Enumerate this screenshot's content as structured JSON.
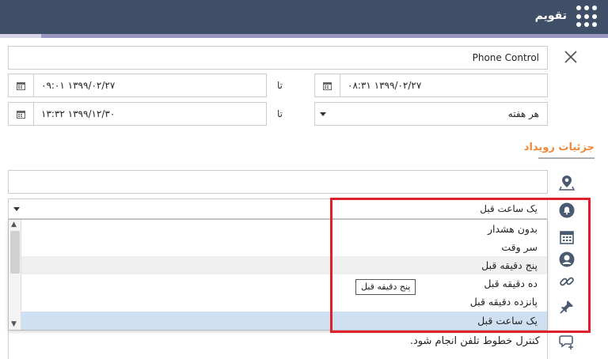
{
  "header": {
    "title": "تقویم",
    "apps_icon": "apps-grid-icon"
  },
  "form": {
    "event_title": "Phone Control",
    "start_date": "۱۳۹۹/۰۲/۲۷ ۰۸:۳۱",
    "end_date": "۱۳۹۹/۰۲/۲۷ ۰۹:۰۱",
    "to_label_1": "تا",
    "recurrence": "هر هفته",
    "to_label_2": "تا",
    "recurrence_end": "۱۳۹۹/۱۲/۳۰ ۱۳:۳۲"
  },
  "details": {
    "section_title": "جزئیات رویداد",
    "location": "",
    "reminder_selected": "یک ساعت قبل",
    "reminder_options": [
      "بدون هشدار",
      "سر وقت",
      "پنج دقیقه قبل",
      "ده دقیقه قبل",
      "پانزده دقیقه قبل",
      "یک ساعت قبل"
    ],
    "tooltip": "پنج دقیقه قبل",
    "description": "کنترل خطوط تلفن انجام شود."
  },
  "colors": {
    "header_bg": "#3e4f67",
    "accent": "#f0883a",
    "highlight": "#e0202a",
    "selected_bg": "#cfe0f3"
  }
}
